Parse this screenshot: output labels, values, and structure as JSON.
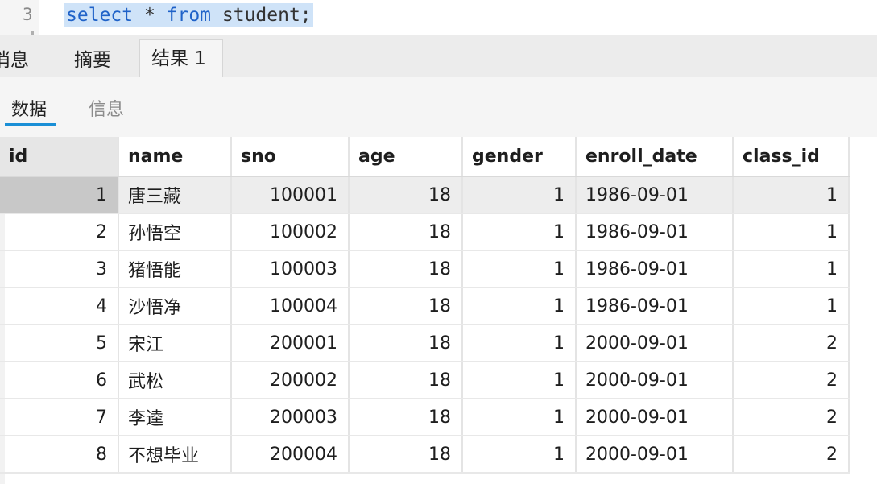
{
  "editor": {
    "line_number": "3",
    "code": {
      "kw1": "select",
      "t1": " * ",
      "kw2": "from",
      "t2": " student;"
    }
  },
  "result_tabs": [
    "消息",
    "摘要",
    "结果 1"
  ],
  "sub_tabs": [
    "数据",
    "信息"
  ],
  "table": {
    "columns": [
      "id",
      "name",
      "sno",
      "age",
      "gender",
      "enroll_date",
      "class_id"
    ],
    "rows": [
      [
        "1",
        "唐三藏",
        "100001",
        "18",
        "1",
        "1986-09-01",
        "1"
      ],
      [
        "2",
        "孙悟空",
        "100002",
        "18",
        "1",
        "1986-09-01",
        "1"
      ],
      [
        "3",
        "猪悟能",
        "100003",
        "18",
        "1",
        "1986-09-01",
        "1"
      ],
      [
        "4",
        "沙悟净",
        "100004",
        "18",
        "1",
        "1986-09-01",
        "1"
      ],
      [
        "5",
        "宋江",
        "200001",
        "18",
        "1",
        "2000-09-01",
        "2"
      ],
      [
        "6",
        "武松",
        "200002",
        "18",
        "1",
        "2000-09-01",
        "2"
      ],
      [
        "7",
        "李逵",
        "200003",
        "18",
        "1",
        "2000-09-01",
        "2"
      ],
      [
        "8",
        "不想毕业",
        "200004",
        "18",
        "1",
        "2000-09-01",
        "2"
      ]
    ]
  },
  "colors": {
    "accent": "#1a8fd6",
    "selection": "#cfe3f8",
    "keyword": "#1f62c8"
  }
}
